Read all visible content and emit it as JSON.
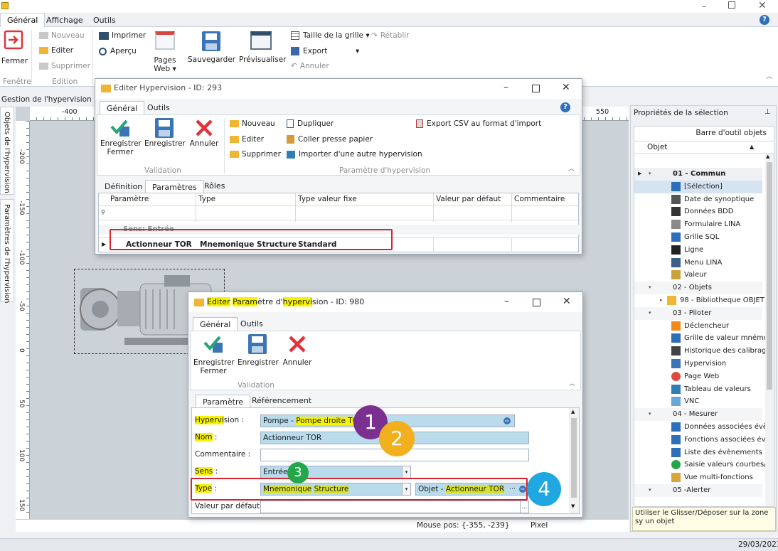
{
  "app": {
    "ribbon_tabs": [
      "Général",
      "Affichage",
      "Outils"
    ],
    "ribbon": {
      "fermer": "Fermer",
      "nouveau": "Nouveau",
      "editer": "Editer",
      "supprimer": "Supprimer",
      "imprimer": "Imprimer",
      "apercu": "Aperçu",
      "pages_web_1": "Pages",
      "pages_web_2": "Web ▾",
      "sauvegarder": "Sauvegarder",
      "previsualiser": "Prévisualiser",
      "taille_grille": "Taille de la grille ▾",
      "retablir": "Rétablir",
      "export": "Export",
      "annuler": "Annuler",
      "group_fenetre": "Fenêtre",
      "group_edition": "Edition"
    },
    "doc_tab": "Gestion de l'hypervision",
    "side_tabs": [
      "Objets de l'hypervision",
      "Paramètres de l'hypervision"
    ],
    "ruler_top": [
      "-400",
      "550"
    ],
    "ruler_left": [
      "-200",
      "-150",
      "-100",
      "-50",
      "0",
      "50",
      "100",
      "150"
    ],
    "status": {
      "mouse_pos": "Mouse pos: {-355, -239}",
      "unit": "Pixel",
      "date": "29/03/2023"
    }
  },
  "props": {
    "title": "Propriétés de la sélection",
    "toolbar_title": "Barre d'outil objets",
    "column": "Objet",
    "tree": [
      {
        "label": "01 - Commun",
        "level": 0,
        "bold": true,
        "icon": ""
      },
      {
        "label": "[Sélection]",
        "level": 1,
        "icon": "cursor-icon",
        "selected": true
      },
      {
        "label": "Date de synoptique",
        "level": 1,
        "icon": "calendar-icon"
      },
      {
        "label": "Données BDD",
        "level": 1,
        "icon": "database-icon"
      },
      {
        "label": "Formulaire LINA",
        "level": 1,
        "icon": "form-icon"
      },
      {
        "label": "Grille SQL",
        "level": 1,
        "icon": "grid-icon"
      },
      {
        "label": "Ligne",
        "level": 1,
        "icon": "line-icon"
      },
      {
        "label": "Menu LINA",
        "level": 1,
        "icon": "menu-icon"
      },
      {
        "label": "Valeur",
        "level": 1,
        "icon": "value-icon"
      },
      {
        "label": "02 - Objets",
        "level": 0,
        "icon": ""
      },
      {
        "label": "98 - Bibliotheque OBJET",
        "level": 1,
        "icon": "folder-icon",
        "expander": true
      },
      {
        "label": "03 - Piloter",
        "level": 0,
        "icon": ""
      },
      {
        "label": "Déclencheur",
        "level": 1,
        "icon": "lightning-icon"
      },
      {
        "label": "Grille de valeur mnémoni",
        "level": 1,
        "icon": "pin-icon"
      },
      {
        "label": "Historique des calibrage",
        "level": 1,
        "icon": "history-icon"
      },
      {
        "label": "Hypervision",
        "level": 1,
        "icon": "monitor-icon"
      },
      {
        "label": "Page Web",
        "level": 1,
        "icon": "chrome-icon"
      },
      {
        "label": "Tableau de valeurs",
        "level": 1,
        "icon": "table-icon"
      },
      {
        "label": "VNC",
        "level": 1,
        "icon": "vnc-icon"
      },
      {
        "label": "04 - Mesurer",
        "level": 0,
        "icon": ""
      },
      {
        "label": "Données associées évè",
        "level": 1,
        "icon": "data-icon"
      },
      {
        "label": "Fonctions associées évè",
        "level": 1,
        "icon": "functions-icon"
      },
      {
        "label": "Liste des évènements",
        "level": 1,
        "icon": "list-icon"
      },
      {
        "label": "Saisie valeurs courbes/o",
        "level": 1,
        "icon": "plus-circle-icon"
      },
      {
        "label": "Vue multi-fonctions",
        "level": 1,
        "icon": "chart-icon"
      },
      {
        "label": "05 -Alerter",
        "level": 0,
        "icon": ""
      }
    ],
    "hint": "Utiliser le Glisser/Déposer sur la zone sy un objet"
  },
  "dlg1": {
    "title": "Editer Hypervision - ID: 293",
    "tabs": [
      "Général",
      "Outils"
    ],
    "btn_save_1": "Enregistrer",
    "btn_save_2": "Fermer",
    "btn_record": "Enregistrer",
    "btn_cancel": "Annuler",
    "group_validation": "Validation",
    "act_nouveau": "Nouveau",
    "act_editer": "Editer",
    "act_supprimer": "Supprimer",
    "act_dupliquer": "Dupliquer",
    "act_coller": "Coller presse papier",
    "act_importer": "Importer d'une autre hypervision",
    "act_export": "Export CSV au format d'import",
    "group_params": "Paramètre d'hypervision",
    "subtabs": [
      "Définition",
      "Paramètres",
      "Rôles"
    ],
    "columns": [
      "Paramètre",
      "Type",
      "Type valeur fixe",
      "Valeur par défaut",
      "Commentaire"
    ],
    "group_row": "Sens: Entrée",
    "row": {
      "parametre": "Actionneur TOR",
      "type": "Mnemonique Structure",
      "type_valeur": "Standard"
    }
  },
  "dlg2": {
    "title_parts": [
      "Editer",
      " ",
      "Param",
      "ètre d'",
      "hypervi",
      "sion - ID: 980"
    ],
    "tabs": [
      "Général",
      "Outils"
    ],
    "btn_save_1": "Enregistrer",
    "btn_save_2": "Fermer",
    "btn_record": "Enregistrer",
    "btn_cancel": "Annuler",
    "group_validation": "Validation",
    "subtabs": [
      "Paramètre",
      "Référencement"
    ],
    "hyp_label_hl": "Hypervi",
    "hyp_label_rest": "sion :",
    "hyp_value_a": "Pompe - ",
    "hyp_value_b": "Pompe droite TOR",
    "nom_label_hl": "Nom",
    "nom_label_rest": " :",
    "nom_value": "Actionneur TOR",
    "commentaire_label": "Commentaire :",
    "sens_label_hl": "Sens",
    "sens_label_rest": " :",
    "sens_value": "Entrée",
    "type_label_hl": "Type",
    "type_label_rest": " :",
    "type_value_a": "Mnemonique",
    "type_value_b": " ",
    "type_value_c": "Structure",
    "obj_value_a": "Objet - ",
    "obj_value_b": "Actionneur TOR",
    "defaut_label": "Valeur par défaut :",
    "ellipsis": "..."
  },
  "callouts": [
    "1",
    "2",
    "3",
    "4"
  ],
  "colors": {
    "purple": "#7b2f8f",
    "orange": "#f2b01e",
    "green": "#24a64a",
    "blue": "#1ea7e1",
    "red": "#d9232f",
    "highlight": "#f7f200"
  }
}
